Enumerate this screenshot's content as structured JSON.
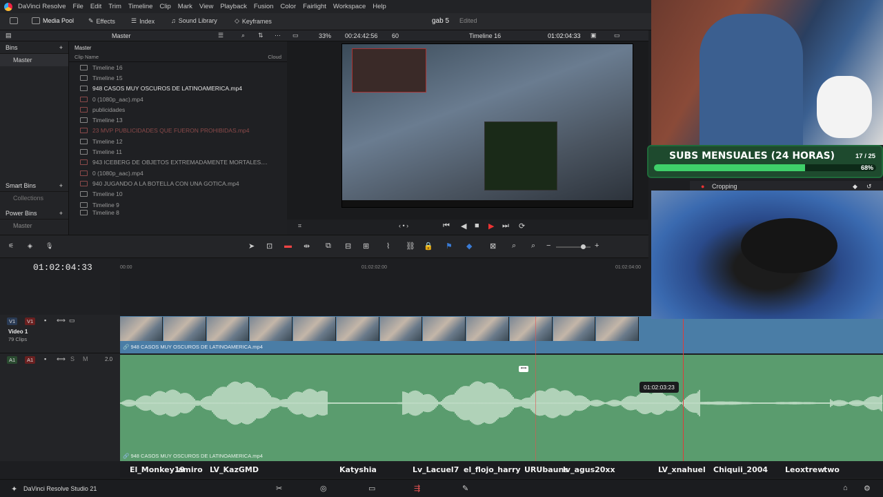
{
  "menubar": {
    "app": "DaVinci Resolve",
    "items": [
      "File",
      "Edit",
      "Trim",
      "Timeline",
      "Clip",
      "Mark",
      "View",
      "Playback",
      "Fusion",
      "Color",
      "Fairlight",
      "Workspace",
      "Help"
    ]
  },
  "toolbar": {
    "media_pool": "Media Pool",
    "effects": "Effects",
    "index": "Index",
    "sound_library": "Sound Library",
    "keyframes": "Keyframes",
    "project_name": "gab 5",
    "project_status": "Edited"
  },
  "subbar": {
    "master": "Master",
    "zoom": "33%",
    "timecode": "00:24:42:56",
    "fps": "60",
    "timeline": "Timeline 16",
    "current_tc": "01:02:04:33"
  },
  "bins": {
    "header": "Bins",
    "master": "Master",
    "smart_bins": "Smart Bins",
    "collections": "Collections",
    "power_bins": "Power Bins",
    "power_master": "Master"
  },
  "cliplist": {
    "breadcrumb": "Master",
    "col_clip_name": "Clip Name",
    "col_cloud": "Cloud",
    "rows": [
      "Timeline 16",
      "Timeline 15",
      "948 CASOS MUY OSCUROS DE LATINOAMERICA.mp4",
      "0 (1080p_aac).mp4",
      "publicidades",
      "Timeline 13",
      "23 MVP PUBLICIDADES QUE FUERON PROHIBIDAS.mp4",
      "Timeline 12",
      "Timeline 11",
      "943 ICEBERG DE OBJETOS EXTREMADAMENTE MORTALES....",
      "0 (1080p_aac).mp4",
      "940 JUGANDO A LA BOTELLA CON UNA GOTICA.mp4",
      "Timeline 10",
      "Timeline 9",
      "Timeline 8"
    ]
  },
  "timeline": {
    "timecode": "01:02:04:33",
    "ruler": [
      "00:00",
      "01:02:02:00",
      "01:02:04:00"
    ],
    "v1_label": "V1",
    "v1_patch": "V1",
    "a1_label": "A1",
    "a1_patch": "A1",
    "video_track_name": "Video 1",
    "video_clip_count": "79 Clips",
    "audio_level": "2.0",
    "video_clip_name": "948 CASOS MUY OSCUROS DE LATINOAMERICA.mp4",
    "audio_clip_name": "948 CASOS MUY OSCUROS DE LATINOAMERICA.mp4",
    "hover_tc": "01:02:03:23"
  },
  "overlay": {
    "subs_title": "SUBS MENSUALES (24 HORAS)",
    "subs_count": "17 / 25",
    "subs_pct": "68%",
    "subs_fraction": 0.68,
    "cropping": "Cropping"
  },
  "names": [
    "El_Monkey19",
    "amiro",
    "LV_KazGMD",
    "Katyshia",
    "Lv_Lacuel7",
    "el_flojo_harry",
    "URUbauns",
    "lv_agus20xx",
    "LV_xnahuel",
    "Chiquii_2004",
    "Leoxtrew",
    "two"
  ],
  "bottombar": {
    "studio": "DaVinci Resolve Studio 21"
  }
}
